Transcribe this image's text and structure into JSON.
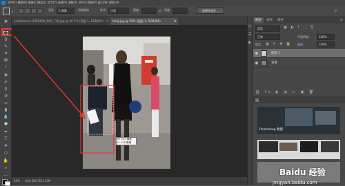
{
  "menu": {
    "items": [
      "文件(F)",
      "编辑(E)",
      "图像(I)",
      "图层(L)",
      "文字(Y)",
      "选择(S)",
      "滤镜(T)",
      "3D(D)",
      "视图(V)",
      "窗口(W)",
      "帮助(H)"
    ]
  },
  "options": {
    "feather_label": "羽化:",
    "feather_value": "0 像素",
    "antialias_label": "消除锯齿",
    "style_label": "样式:",
    "style_value": "正常",
    "width_label": "宽度:",
    "height_label": "高度:",
    "select_mask_button": "选择并遮住..."
  },
  "tabs": [
    {
      "label": "architecture-2960600_960_720.jpg @ 66.7% (图层 1, RGB/8#)",
      "active": false
    },
    {
      "label": "timg.jpg @ 50% (图层 1, RGB/8#)",
      "active": true
    }
  ],
  "canvas": {
    "tooltip_w": "W: 115 像素",
    "tooltip_h": "H: 228 像素"
  },
  "status": {
    "zoom": "50%",
    "doc": "文档:484.7K/1.21M"
  },
  "right_panel": {
    "tabs": [
      "图层",
      "通道",
      "路径"
    ],
    "search_label": "类型",
    "blend_mode": "正常",
    "opacity_label": "不透明度:",
    "opacity_value": "100%",
    "lock_label": "锁定:",
    "fill_label": "填充:",
    "fill_value": "100%",
    "layers": [
      {
        "name": "图层 1",
        "selected": true
      },
      {
        "name": "背景",
        "selected": false
      }
    ],
    "learn_title": "Photoshop 教程"
  },
  "watermark": {
    "brand": "Baidu 经验",
    "url": "jingyan.baidu.com"
  },
  "colors": {
    "annotation_red": "#e53935",
    "selection": "#ffffff"
  }
}
